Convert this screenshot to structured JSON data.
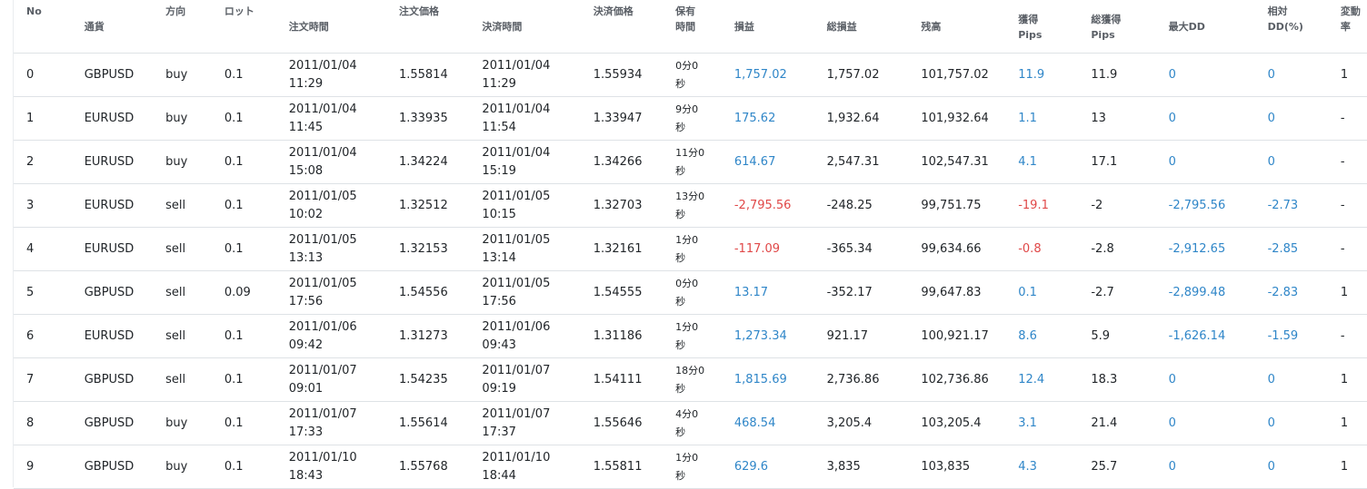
{
  "headers": {
    "no": "No",
    "currency": "通貨",
    "direction": "方向",
    "lot": "ロット",
    "order_time": "注文時間",
    "order_price": "注文価格",
    "close_time": "決済時間",
    "close_price": "決済価格",
    "hold_l1": "保有",
    "hold_l2": "時間",
    "pnl": "損益",
    "total_pnl": "総損益",
    "balance": "残高",
    "pips_l1": "獲得",
    "pips_l2": "Pips",
    "total_pips_l1": "総獲得",
    "total_pips_l2": "Pips",
    "max_dd": "最大DD",
    "rel_dd_l1": "相対",
    "rel_dd_l2": "DD(%)",
    "change_l1": "変動",
    "change_l2": "率"
  },
  "colors": {
    "positive": "#2f86c8",
    "negative": "#e04848",
    "text": "#212529"
  },
  "rows": [
    {
      "no": "0",
      "currency": "GBPUSD",
      "direction": "buy",
      "lot": "0.1",
      "order_date": "2011/01/04",
      "order_clock": "11:29",
      "order_price": "1.55814",
      "close_date": "2011/01/04",
      "close_clock": "11:29",
      "close_price": "1.55934",
      "hold_l1": "0分0",
      "hold_l2": "秒",
      "pnl": "1,757.02",
      "pnl_neg": false,
      "total_pnl": "1,757.02",
      "balance": "101,757.02",
      "pips": "11.9",
      "pips_neg": false,
      "total_pips": "11.9",
      "max_dd": "0",
      "rel_dd": "0",
      "change": "1"
    },
    {
      "no": "1",
      "currency": "EURUSD",
      "direction": "buy",
      "lot": "0.1",
      "order_date": "2011/01/04",
      "order_clock": "11:45",
      "order_price": "1.33935",
      "close_date": "2011/01/04",
      "close_clock": "11:54",
      "close_price": "1.33947",
      "hold_l1": "9分0",
      "hold_l2": "秒",
      "pnl": "175.62",
      "pnl_neg": false,
      "total_pnl": "1,932.64",
      "balance": "101,932.64",
      "pips": "1.1",
      "pips_neg": false,
      "total_pips": "13",
      "max_dd": "0",
      "rel_dd": "0",
      "change": "-"
    },
    {
      "no": "2",
      "currency": "EURUSD",
      "direction": "buy",
      "lot": "0.1",
      "order_date": "2011/01/04",
      "order_clock": "15:08",
      "order_price": "1.34224",
      "close_date": "2011/01/04",
      "close_clock": "15:19",
      "close_price": "1.34266",
      "hold_l1": "11分0",
      "hold_l2": "秒",
      "pnl": "614.67",
      "pnl_neg": false,
      "total_pnl": "2,547.31",
      "balance": "102,547.31",
      "pips": "4.1",
      "pips_neg": false,
      "total_pips": "17.1",
      "max_dd": "0",
      "rel_dd": "0",
      "change": "-"
    },
    {
      "no": "3",
      "currency": "EURUSD",
      "direction": "sell",
      "lot": "0.1",
      "order_date": "2011/01/05",
      "order_clock": "10:02",
      "order_price": "1.32512",
      "close_date": "2011/01/05",
      "close_clock": "10:15",
      "close_price": "1.32703",
      "hold_l1": "13分0",
      "hold_l2": "秒",
      "pnl": "-2,795.56",
      "pnl_neg": true,
      "total_pnl": "-248.25",
      "balance": "99,751.75",
      "pips": "-19.1",
      "pips_neg": true,
      "total_pips": "-2",
      "max_dd": "-2,795.56",
      "rel_dd": "-2.73",
      "change": "-"
    },
    {
      "no": "4",
      "currency": "EURUSD",
      "direction": "sell",
      "lot": "0.1",
      "order_date": "2011/01/05",
      "order_clock": "13:13",
      "order_price": "1.32153",
      "close_date": "2011/01/05",
      "close_clock": "13:14",
      "close_price": "1.32161",
      "hold_l1": "1分0",
      "hold_l2": "秒",
      "pnl": "-117.09",
      "pnl_neg": true,
      "total_pnl": "-365.34",
      "balance": "99,634.66",
      "pips": "-0.8",
      "pips_neg": true,
      "total_pips": "-2.8",
      "max_dd": "-2,912.65",
      "rel_dd": "-2.85",
      "change": "-"
    },
    {
      "no": "5",
      "currency": "GBPUSD",
      "direction": "sell",
      "lot": "0.09",
      "order_date": "2011/01/05",
      "order_clock": "17:56",
      "order_price": "1.54556",
      "close_date": "2011/01/05",
      "close_clock": "17:56",
      "close_price": "1.54555",
      "hold_l1": "0分0",
      "hold_l2": "秒",
      "pnl": "13.17",
      "pnl_neg": false,
      "total_pnl": "-352.17",
      "balance": "99,647.83",
      "pips": "0.1",
      "pips_neg": false,
      "total_pips": "-2.7",
      "max_dd": "-2,899.48",
      "rel_dd": "-2.83",
      "change": "1"
    },
    {
      "no": "6",
      "currency": "EURUSD",
      "direction": "sell",
      "lot": "0.1",
      "order_date": "2011/01/06",
      "order_clock": "09:42",
      "order_price": "1.31273",
      "close_date": "2011/01/06",
      "close_clock": "09:43",
      "close_price": "1.31186",
      "hold_l1": "1分0",
      "hold_l2": "秒",
      "pnl": "1,273.34",
      "pnl_neg": false,
      "total_pnl": "921.17",
      "balance": "100,921.17",
      "pips": "8.6",
      "pips_neg": false,
      "total_pips": "5.9",
      "max_dd": "-1,626.14",
      "rel_dd": "-1.59",
      "change": "-"
    },
    {
      "no": "7",
      "currency": "GBPUSD",
      "direction": "sell",
      "lot": "0.1",
      "order_date": "2011/01/07",
      "order_clock": "09:01",
      "order_price": "1.54235",
      "close_date": "2011/01/07",
      "close_clock": "09:19",
      "close_price": "1.54111",
      "hold_l1": "18分0",
      "hold_l2": "秒",
      "pnl": "1,815.69",
      "pnl_neg": false,
      "total_pnl": "2,736.86",
      "balance": "102,736.86",
      "pips": "12.4",
      "pips_neg": false,
      "total_pips": "18.3",
      "max_dd": "0",
      "rel_dd": "0",
      "change": "1"
    },
    {
      "no": "8",
      "currency": "GBPUSD",
      "direction": "buy",
      "lot": "0.1",
      "order_date": "2011/01/07",
      "order_clock": "17:33",
      "order_price": "1.55614",
      "close_date": "2011/01/07",
      "close_clock": "17:37",
      "close_price": "1.55646",
      "hold_l1": "4分0",
      "hold_l2": "秒",
      "pnl": "468.54",
      "pnl_neg": false,
      "total_pnl": "3,205.4",
      "balance": "103,205.4",
      "pips": "3.1",
      "pips_neg": false,
      "total_pips": "21.4",
      "max_dd": "0",
      "rel_dd": "0",
      "change": "1"
    },
    {
      "no": "9",
      "currency": "GBPUSD",
      "direction": "buy",
      "lot": "0.1",
      "order_date": "2011/01/10",
      "order_clock": "18:43",
      "order_price": "1.55768",
      "close_date": "2011/01/10",
      "close_clock": "18:44",
      "close_price": "1.55811",
      "hold_l1": "1分0",
      "hold_l2": "秒",
      "pnl": "629.6",
      "pnl_neg": false,
      "total_pnl": "3,835",
      "balance": "103,835",
      "pips": "4.3",
      "pips_neg": false,
      "total_pips": "25.7",
      "max_dd": "0",
      "rel_dd": "0",
      "change": "1"
    }
  ]
}
